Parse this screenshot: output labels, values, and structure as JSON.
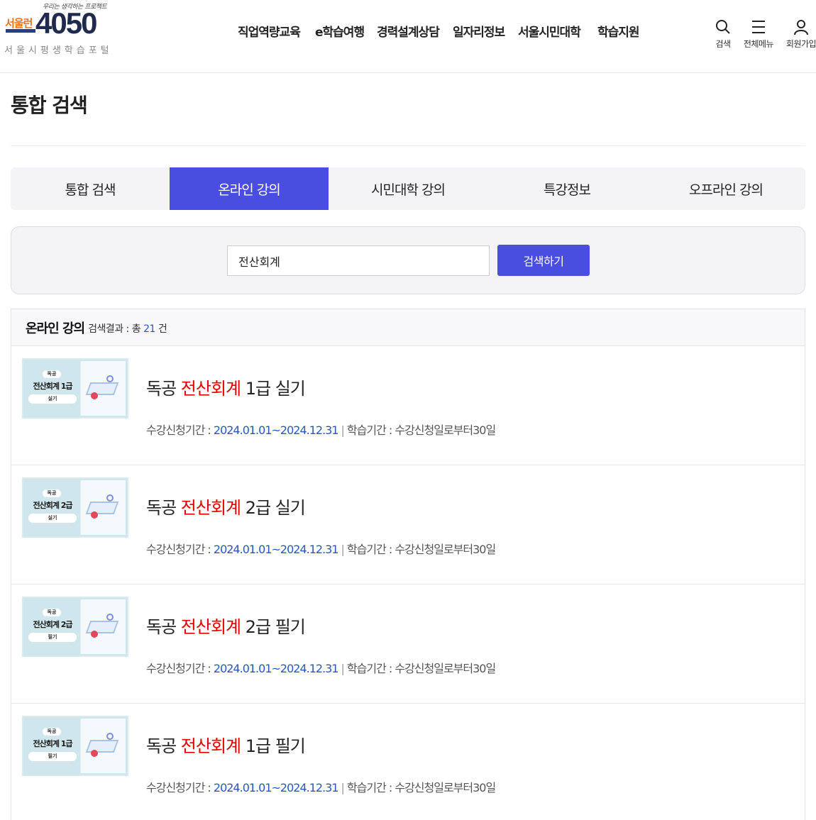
{
  "header": {
    "logo": {
      "tagline": "우리는 생각하는 프로젝트",
      "brand": "서울런",
      "number": "4050",
      "subtitle": "서울시평생학습포털"
    },
    "nav": [
      "직업역량교육",
      "e학습여행",
      "경력설계상담",
      "일자리정보",
      "서울시민대학",
      "학습지원"
    ],
    "utils": {
      "search": "검색",
      "menu": "전체메뉴",
      "signup": "회원가입"
    }
  },
  "page": {
    "title": "통합 검색"
  },
  "tabs": [
    "통합 검색",
    "온라인 강의",
    "시민대학 강의",
    "특강정보",
    "오프라인 강의"
  ],
  "active_tab": 1,
  "search": {
    "value": "전산회계",
    "button": "검색하기"
  },
  "results": {
    "category": "온라인 강의",
    "count_prefix": "검색결과 : 총",
    "count": "21",
    "count_suffix": "건",
    "items": [
      {
        "prefix": "독공 ",
        "highlight": "전산회계",
        "suffix": " 1급 실기",
        "thumb_badge": "독공",
        "thumb_title": "전산회계 1급",
        "thumb_sub": "실기",
        "apply_label": "수강신청기간 :",
        "apply_period": "2024.01.01~2024.12.31",
        "study_label": "학습기간 :",
        "study_period": "수강신청일로부터30일"
      },
      {
        "prefix": "독공 ",
        "highlight": "전산회계",
        "suffix": " 2급 실기",
        "thumb_badge": "독공",
        "thumb_title": "전산회계 2급",
        "thumb_sub": "실기",
        "apply_label": "수강신청기간 :",
        "apply_period": "2024.01.01~2024.12.31",
        "study_label": "학습기간 :",
        "study_period": "수강신청일로부터30일"
      },
      {
        "prefix": "독공 ",
        "highlight": "전산회계",
        "suffix": " 2급 필기",
        "thumb_badge": "독공",
        "thumb_title": "전산회계 2급",
        "thumb_sub": "필기",
        "apply_label": "수강신청기간 :",
        "apply_period": "2024.01.01~2024.12.31",
        "study_label": "학습기간 :",
        "study_period": "수강신청일로부터30일"
      },
      {
        "prefix": "독공 ",
        "highlight": "전산회계",
        "suffix": " 1급 필기",
        "thumb_badge": "독공",
        "thumb_title": "전산회계 1급",
        "thumb_sub": "필기",
        "apply_label": "수강신청기간 :",
        "apply_period": "2024.01.01~2024.12.31",
        "study_label": "학습기간 :",
        "study_period": "수강신청일로부터30일"
      }
    ]
  },
  "colors": {
    "accent": "#4a4ee0",
    "highlight": "#e00000",
    "date": "#2a56b8"
  }
}
